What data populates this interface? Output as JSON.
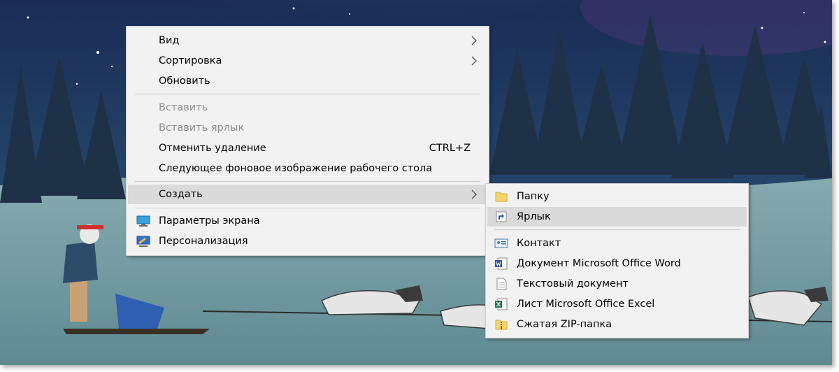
{
  "main_menu": {
    "items": [
      {
        "label": "Вид"
      },
      {
        "label": "Сортировка"
      },
      {
        "label": "Обновить"
      },
      {
        "label": "Вставить"
      },
      {
        "label": "Вставить ярлык"
      },
      {
        "label": "Отменить удаление",
        "shortcut": "CTRL+Z"
      },
      {
        "label": "Следующее фоновое изображение рабочего стола"
      },
      {
        "label": "Создать"
      },
      {
        "label": "Параметры экрана",
        "icon": "display-icon"
      },
      {
        "label": "Персонализация",
        "icon": "personalize-icon"
      }
    ]
  },
  "sub_menu": {
    "items": [
      {
        "label": "Папку",
        "icon": "folder-icon"
      },
      {
        "label": "Ярлык",
        "icon": "shortcut-icon"
      },
      {
        "label": "Контакт",
        "icon": "contact-icon"
      },
      {
        "label": "Документ Microsoft Office Word",
        "icon": "word-icon"
      },
      {
        "label": "Текстовый документ",
        "icon": "text-doc-icon"
      },
      {
        "label": "Лист Microsoft Office Excel",
        "icon": "excel-icon"
      },
      {
        "label": "Сжатая ZIP-папка",
        "icon": "zip-folder-icon"
      }
    ]
  },
  "colors": {
    "menu_bg": "#f2f2f2",
    "highlight": "#dadada",
    "disabled_text": "#8d8d8d",
    "sky_top": "#1c2f52",
    "aurora": "#4fb06a",
    "snow": "#7fa3a8"
  }
}
